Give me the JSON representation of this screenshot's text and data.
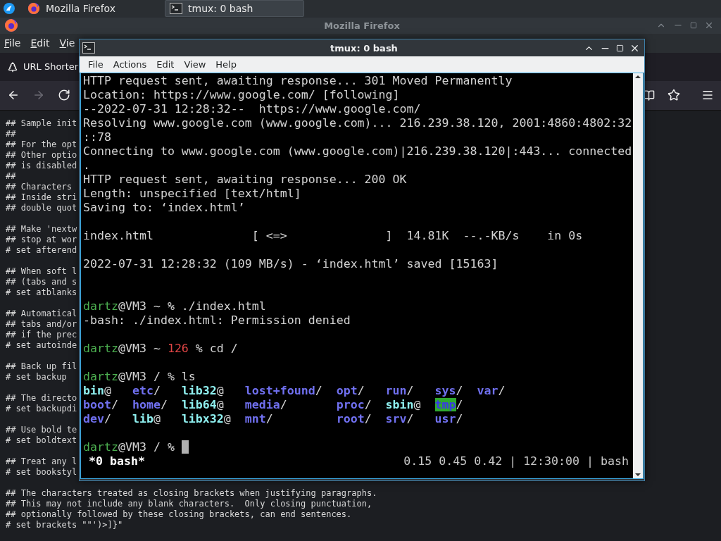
{
  "taskbar": {
    "tasks": [
      {
        "kind": "browser",
        "label": "Mozilla Firefox",
        "selected": false
      },
      {
        "kind": "terminal",
        "label": "tmux: 0 bash",
        "selected": true
      }
    ]
  },
  "browser": {
    "title": "Mozilla Firefox",
    "menu": [
      "File",
      "Edit",
      "Vie"
    ],
    "tab": {
      "label": "URL Shorter"
    },
    "nav": [
      {
        "kind": "back",
        "disabled": false
      },
      {
        "kind": "forward",
        "disabled": true
      },
      {
        "kind": "reload",
        "disabled": false
      }
    ],
    "text_blocks": [
      [
        "## Sample init",
        "##",
        "## For the opt",
        "## Other optio",
        "## is disabled",
        "##",
        "## Characters",
        "## Inside stri",
        "## double quot"
      ],
      [
        "## Make 'nextw",
        "## stop at wor",
        "# set afterend"
      ],
      [
        "## When soft l",
        "## (tabs and s",
        "# set atblanks"
      ],
      [
        "## Automatical",
        "## tabs and/or",
        "## if the prec",
        "# set autoinde"
      ],
      [
        "## Back up fil",
        "# set backup"
      ],
      [
        "## The directo",
        "# set backupdi"
      ],
      [
        "## Use bold te",
        "# set boldtext"
      ],
      [
        "## Treat any l",
        "# set bookstyl"
      ],
      [
        "## The characters treated as closing brackets when justifying paragraphs.",
        "## This may not include any blank characters.  Only closing punctuation,",
        "## optionally followed by these closing brackets, can end sentences.",
        "# set brackets \"\"')>]}\""
      ]
    ]
  },
  "terminal": {
    "title": "tmux: 0 bash",
    "menu": [
      "File",
      "Actions",
      "Edit",
      "View",
      "Help"
    ],
    "lines": [
      {
        "kind": "text",
        "text": "HTTP request sent, awaiting response... 301 Moved Permanently"
      },
      {
        "kind": "text",
        "text": "Location: https://www.google.com/ [following]"
      },
      {
        "kind": "text",
        "text": "--2022-07-31 12:28:32--  https://www.google.com/"
      },
      {
        "kind": "text",
        "text": "Resolving www.google.com (www.google.com)... 216.239.38.120, 2001:4860:4802:32"
      },
      {
        "kind": "text",
        "text": "::78"
      },
      {
        "kind": "text",
        "text": "Connecting to www.google.com (www.google.com)|216.239.38.120|:443... connected"
      },
      {
        "kind": "text",
        "text": "."
      },
      {
        "kind": "text",
        "text": "HTTP request sent, awaiting response... 200 OK"
      },
      {
        "kind": "text",
        "text": "Length: unspecified [text/html]"
      },
      {
        "kind": "text",
        "text": "Saving to: ‘index.html’"
      },
      {
        "kind": "blank"
      },
      {
        "kind": "text",
        "text": "index.html              [ <=>              ]  14.81K  --.-KB/s    in 0s"
      },
      {
        "kind": "blank"
      },
      {
        "kind": "text",
        "text": "2022-07-31 12:28:32 (109 MB/s) - ‘index.html’ saved [15163]"
      },
      {
        "kind": "blank"
      },
      {
        "kind": "blank"
      },
      {
        "kind": "prompt",
        "cursor": false,
        "segments": [
          {
            "kind": "user",
            "text": "dartz"
          },
          {
            "kind": "plain",
            "text": "@VM3 ~ % ./index.html"
          }
        ]
      },
      {
        "kind": "text",
        "text": "-bash: ./index.html: Permission denied"
      },
      {
        "kind": "blank"
      },
      {
        "kind": "prompt",
        "cursor": false,
        "segments": [
          {
            "kind": "user",
            "text": "dartz"
          },
          {
            "kind": "plain",
            "text": "@VM3 ~ "
          },
          {
            "kind": "error",
            "text": "126"
          },
          {
            "kind": "plain",
            "text": " % cd /"
          }
        ]
      },
      {
        "kind": "blank"
      },
      {
        "kind": "prompt",
        "cursor": false,
        "segments": [
          {
            "kind": "user",
            "text": "dartz"
          },
          {
            "kind": "plain",
            "text": "@VM3 / % ls"
          }
        ]
      },
      {
        "kind": "listing",
        "columns": [
          [
            {
              "kind": "link",
              "name": "bin",
              "suffix": "@"
            },
            {
              "kind": "dir",
              "name": "boot",
              "suffix": "/"
            },
            {
              "kind": "dir",
              "name": "dev",
              "suffix": "/"
            }
          ],
          [
            {
              "kind": "dir",
              "name": "etc",
              "suffix": "/"
            },
            {
              "kind": "dir",
              "name": "home",
              "suffix": "/"
            },
            {
              "kind": "link",
              "name": "lib",
              "suffix": "@"
            }
          ],
          [
            {
              "kind": "link",
              "name": "lib32",
              "suffix": "@"
            },
            {
              "kind": "link",
              "name": "lib64",
              "suffix": "@"
            },
            {
              "kind": "link",
              "name": "libx32",
              "suffix": "@"
            }
          ],
          [
            {
              "kind": "dir",
              "name": "lost+found",
              "suffix": "/"
            },
            {
              "kind": "dir",
              "name": "media",
              "suffix": "/"
            },
            {
              "kind": "dir",
              "name": "mnt",
              "suffix": "/"
            }
          ],
          [
            {
              "kind": "dir",
              "name": "opt",
              "suffix": "/"
            },
            {
              "kind": "dir",
              "name": "proc",
              "suffix": "/"
            },
            {
              "kind": "dir",
              "name": "root",
              "suffix": "/"
            }
          ],
          [
            {
              "kind": "dir",
              "name": "run",
              "suffix": "/"
            },
            {
              "kind": "link",
              "name": "sbin",
              "suffix": "@"
            },
            {
              "kind": "dir",
              "name": "srv",
              "suffix": "/"
            }
          ],
          [
            {
              "kind": "dir",
              "name": "sys",
              "suffix": "/"
            },
            {
              "kind": "sticky",
              "name": "tmp",
              "suffix": "/"
            },
            {
              "kind": "dir",
              "name": "usr",
              "suffix": "/"
            }
          ],
          [
            {
              "kind": "dir",
              "name": "var",
              "suffix": "/"
            }
          ]
        ]
      },
      {
        "kind": "blank"
      },
      {
        "kind": "prompt",
        "cursor": true,
        "segments": [
          {
            "kind": "user",
            "text": "dartz"
          },
          {
            "kind": "plain",
            "text": "@VM3 / % "
          }
        ]
      }
    ],
    "status_bar": {
      "window": "*0 bash*",
      "info": "0.15 0.45 0.42 | 12:30:00 | bash"
    }
  }
}
